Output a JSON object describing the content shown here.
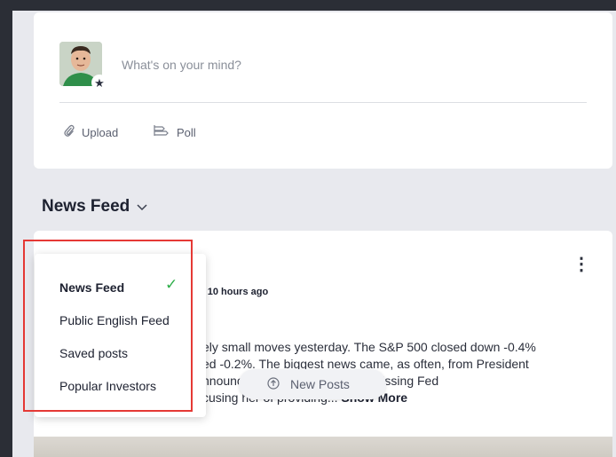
{
  "composer": {
    "placeholder": "What's on your mind?",
    "upload_label": "Upload",
    "poll_label": "Poll"
  },
  "feed_header": {
    "title": "News Feed"
  },
  "post": {
    "time": "t 10 hours ago",
    "text_lines": [
      "ely small moves yesterday. The S&P 500 closed down -0.4%",
      "ed -0.2%. The biggest news came, as often, from President",
      "nnounced                at he is dismissing Fed",
      "cusing her of providing..."
    ],
    "show_more": "Show More"
  },
  "new_posts": {
    "label": "New Posts"
  },
  "dropdown": {
    "items": [
      {
        "label": "News Feed",
        "selected": true
      },
      {
        "label": "Public English Feed",
        "selected": false
      },
      {
        "label": "Saved posts",
        "selected": false
      },
      {
        "label": "Popular Investors",
        "selected": false
      }
    ]
  },
  "colors": {
    "check": "#2fae4a",
    "highlight": "#e53935",
    "background": "#e8e9ee"
  }
}
